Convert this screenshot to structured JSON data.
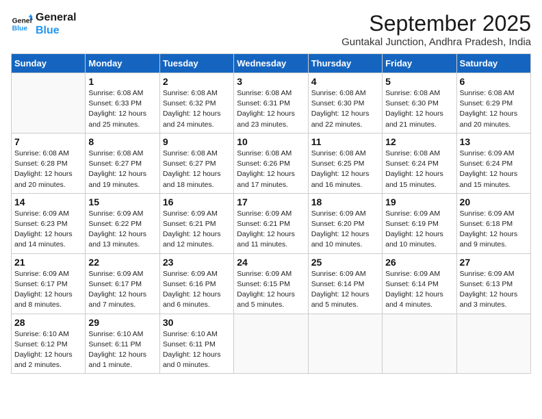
{
  "logo": {
    "line1": "General",
    "line2": "Blue"
  },
  "title": "September 2025",
  "location": "Guntakal Junction, Andhra Pradesh, India",
  "days_of_week": [
    "Sunday",
    "Monday",
    "Tuesday",
    "Wednesday",
    "Thursday",
    "Friday",
    "Saturday"
  ],
  "weeks": [
    [
      {
        "day": "",
        "info": ""
      },
      {
        "day": "1",
        "info": "Sunrise: 6:08 AM\nSunset: 6:33 PM\nDaylight: 12 hours\nand 25 minutes."
      },
      {
        "day": "2",
        "info": "Sunrise: 6:08 AM\nSunset: 6:32 PM\nDaylight: 12 hours\nand 24 minutes."
      },
      {
        "day": "3",
        "info": "Sunrise: 6:08 AM\nSunset: 6:31 PM\nDaylight: 12 hours\nand 23 minutes."
      },
      {
        "day": "4",
        "info": "Sunrise: 6:08 AM\nSunset: 6:30 PM\nDaylight: 12 hours\nand 22 minutes."
      },
      {
        "day": "5",
        "info": "Sunrise: 6:08 AM\nSunset: 6:30 PM\nDaylight: 12 hours\nand 21 minutes."
      },
      {
        "day": "6",
        "info": "Sunrise: 6:08 AM\nSunset: 6:29 PM\nDaylight: 12 hours\nand 20 minutes."
      }
    ],
    [
      {
        "day": "7",
        "info": "Sunrise: 6:08 AM\nSunset: 6:28 PM\nDaylight: 12 hours\nand 20 minutes."
      },
      {
        "day": "8",
        "info": "Sunrise: 6:08 AM\nSunset: 6:27 PM\nDaylight: 12 hours\nand 19 minutes."
      },
      {
        "day": "9",
        "info": "Sunrise: 6:08 AM\nSunset: 6:27 PM\nDaylight: 12 hours\nand 18 minutes."
      },
      {
        "day": "10",
        "info": "Sunrise: 6:08 AM\nSunset: 6:26 PM\nDaylight: 12 hours\nand 17 minutes."
      },
      {
        "day": "11",
        "info": "Sunrise: 6:08 AM\nSunset: 6:25 PM\nDaylight: 12 hours\nand 16 minutes."
      },
      {
        "day": "12",
        "info": "Sunrise: 6:08 AM\nSunset: 6:24 PM\nDaylight: 12 hours\nand 15 minutes."
      },
      {
        "day": "13",
        "info": "Sunrise: 6:09 AM\nSunset: 6:24 PM\nDaylight: 12 hours\nand 15 minutes."
      }
    ],
    [
      {
        "day": "14",
        "info": "Sunrise: 6:09 AM\nSunset: 6:23 PM\nDaylight: 12 hours\nand 14 minutes."
      },
      {
        "day": "15",
        "info": "Sunrise: 6:09 AM\nSunset: 6:22 PM\nDaylight: 12 hours\nand 13 minutes."
      },
      {
        "day": "16",
        "info": "Sunrise: 6:09 AM\nSunset: 6:21 PM\nDaylight: 12 hours\nand 12 minutes."
      },
      {
        "day": "17",
        "info": "Sunrise: 6:09 AM\nSunset: 6:21 PM\nDaylight: 12 hours\nand 11 minutes."
      },
      {
        "day": "18",
        "info": "Sunrise: 6:09 AM\nSunset: 6:20 PM\nDaylight: 12 hours\nand 10 minutes."
      },
      {
        "day": "19",
        "info": "Sunrise: 6:09 AM\nSunset: 6:19 PM\nDaylight: 12 hours\nand 10 minutes."
      },
      {
        "day": "20",
        "info": "Sunrise: 6:09 AM\nSunset: 6:18 PM\nDaylight: 12 hours\nand 9 minutes."
      }
    ],
    [
      {
        "day": "21",
        "info": "Sunrise: 6:09 AM\nSunset: 6:17 PM\nDaylight: 12 hours\nand 8 minutes."
      },
      {
        "day": "22",
        "info": "Sunrise: 6:09 AM\nSunset: 6:17 PM\nDaylight: 12 hours\nand 7 minutes."
      },
      {
        "day": "23",
        "info": "Sunrise: 6:09 AM\nSunset: 6:16 PM\nDaylight: 12 hours\nand 6 minutes."
      },
      {
        "day": "24",
        "info": "Sunrise: 6:09 AM\nSunset: 6:15 PM\nDaylight: 12 hours\nand 5 minutes."
      },
      {
        "day": "25",
        "info": "Sunrise: 6:09 AM\nSunset: 6:14 PM\nDaylight: 12 hours\nand 5 minutes."
      },
      {
        "day": "26",
        "info": "Sunrise: 6:09 AM\nSunset: 6:14 PM\nDaylight: 12 hours\nand 4 minutes."
      },
      {
        "day": "27",
        "info": "Sunrise: 6:09 AM\nSunset: 6:13 PM\nDaylight: 12 hours\nand 3 minutes."
      }
    ],
    [
      {
        "day": "28",
        "info": "Sunrise: 6:10 AM\nSunset: 6:12 PM\nDaylight: 12 hours\nand 2 minutes."
      },
      {
        "day": "29",
        "info": "Sunrise: 6:10 AM\nSunset: 6:11 PM\nDaylight: 12 hours\nand 1 minute."
      },
      {
        "day": "30",
        "info": "Sunrise: 6:10 AM\nSunset: 6:11 PM\nDaylight: 12 hours\nand 0 minutes."
      },
      {
        "day": "",
        "info": ""
      },
      {
        "day": "",
        "info": ""
      },
      {
        "day": "",
        "info": ""
      },
      {
        "day": "",
        "info": ""
      }
    ]
  ]
}
